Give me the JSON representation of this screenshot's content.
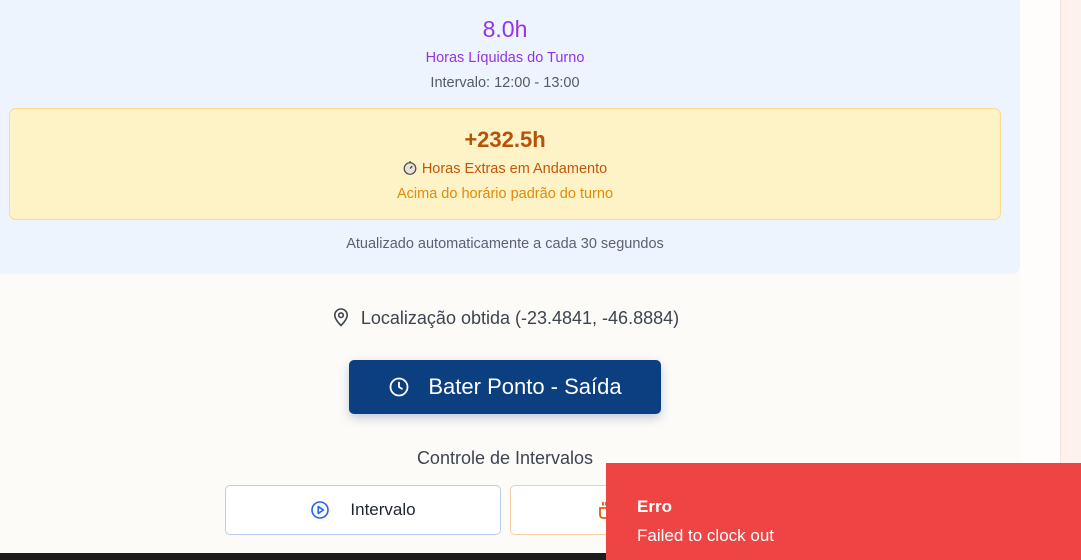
{
  "shift_summary": {
    "net_hours": "8.0h",
    "net_hours_label": "Horas Líquidas do Turno",
    "interval_text": "Intervalo: 12:00 - 13:00"
  },
  "overtime": {
    "value": "+232.5h",
    "label": "Horas Extras em Andamento",
    "sublabel": "Acima do horário padrão do turno",
    "icon": "stopwatch-icon"
  },
  "updated_text": "Atualizado automaticamente a cada 30 segundos",
  "location": {
    "text": "Localização obtida (-23.4841, -46.8884)",
    "icon": "map-pin-icon"
  },
  "clock_button": {
    "label": "Bater Ponto - Saída",
    "icon": "clock-icon"
  },
  "intervals": {
    "heading": "Controle de Intervalos",
    "start_label": "Intervalo",
    "start_icon": "play-circle-icon",
    "end_icon": "coffee-icon"
  },
  "toast": {
    "title": "Erro",
    "message": "Failed to clock out"
  },
  "colors": {
    "accent_purple": "#9333ea",
    "overtime_bg": "#fef3c6",
    "overtime_text": "#b45309",
    "primary_button": "#0b3f80",
    "toast_bg": "#ef4444",
    "card_bg": "#eef4fe"
  }
}
